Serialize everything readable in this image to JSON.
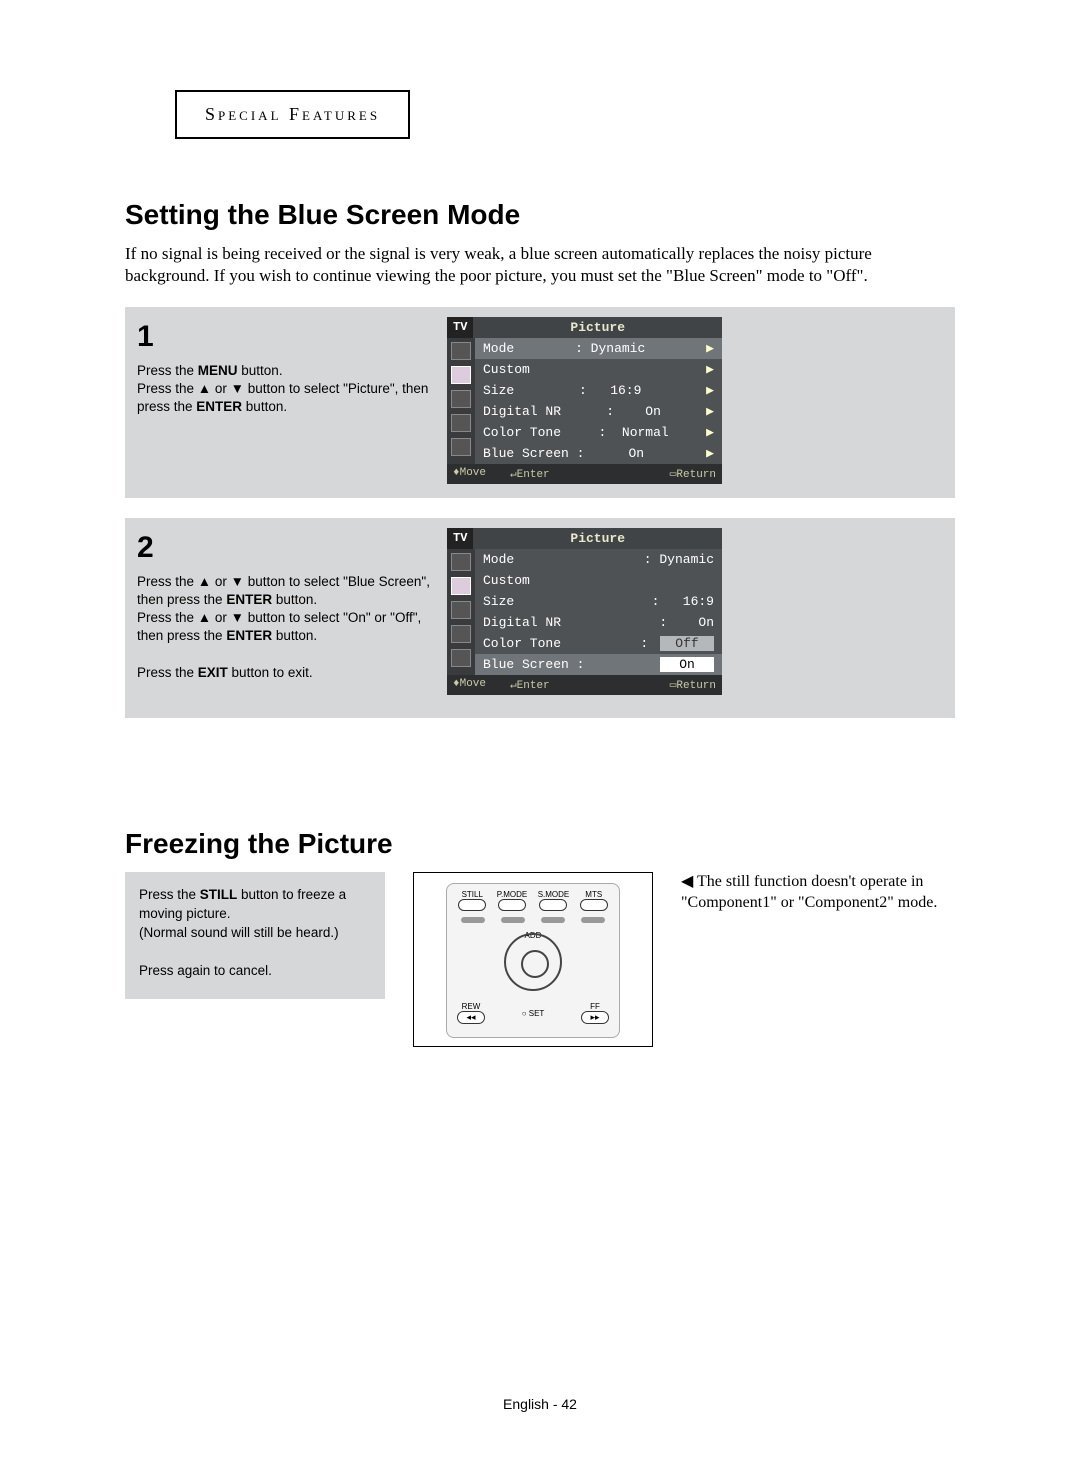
{
  "chapter": "Special Features",
  "section1": {
    "title": "Setting the Blue Screen Mode",
    "intro": "If no signal is being received or the signal is very weak, a blue screen automatically replaces the noisy picture background. If you wish to continue viewing the poor picture, you must set the \"Blue Screen\" mode to \"Off\"."
  },
  "step1": {
    "num": "1",
    "line1_a": "Press the ",
    "line1_b": "MENU",
    "line1_c": " button.",
    "line2": "Press the ▲ or ▼ button to select \"Picture\", then press the ",
    "line2b": "ENTER",
    "line2c": " button."
  },
  "step2": {
    "num": "2",
    "line1": "Press the ▲ or ▼ button to select \"Blue Screen\", then press the ",
    "line1b": "ENTER",
    "line1c": " button.",
    "line2": "Press the ▲ or ▼ button to select \"On\" or \"Off\", then press the ",
    "line2b": "ENTER",
    "line2c": " button.",
    "exit_a": "Press the ",
    "exit_b": "EXIT",
    "exit_c": " button to exit."
  },
  "osd": {
    "tv": "TV",
    "title": "Picture",
    "mode_lbl": "Mode",
    "mode_val": ": Dynamic",
    "custom": "Custom",
    "size_lbl": "Size",
    "size_val": ":   16:9",
    "dnr_lbl": "Digital NR",
    "dnr_val": ":    On",
    "ct_lbl": "Color Tone",
    "ct_val_1": ":  Normal",
    "ct_val_2_sel": "Off",
    "bs_lbl": "Blue Screen :",
    "bs_val_1": "On",
    "bs_val_2_sel": "On",
    "move": "♦Move",
    "enter": "↵Enter",
    "return": "▭Return"
  },
  "section2": {
    "title": "Freezing the Picture"
  },
  "freeze": {
    "line1a": "Press the ",
    "line1b": "STILL",
    "line1c": " button to freeze a moving picture.",
    "line2": "(Normal sound will still be heard.)",
    "line3": "Press again to cancel."
  },
  "remote": {
    "still": "STILL",
    "pmode": "P.MODE",
    "smode": "S.MODE",
    "mts": "MTS",
    "add": "ADD",
    "rew": "REW",
    "ff": "FF",
    "set": "○ SET",
    "rew_sym": "◂◂",
    "ff_sym": "▸▸"
  },
  "note": "◀ The still function doesn't operate in \"Component1\" or \"Component2\" mode.",
  "footer": "English - 42"
}
